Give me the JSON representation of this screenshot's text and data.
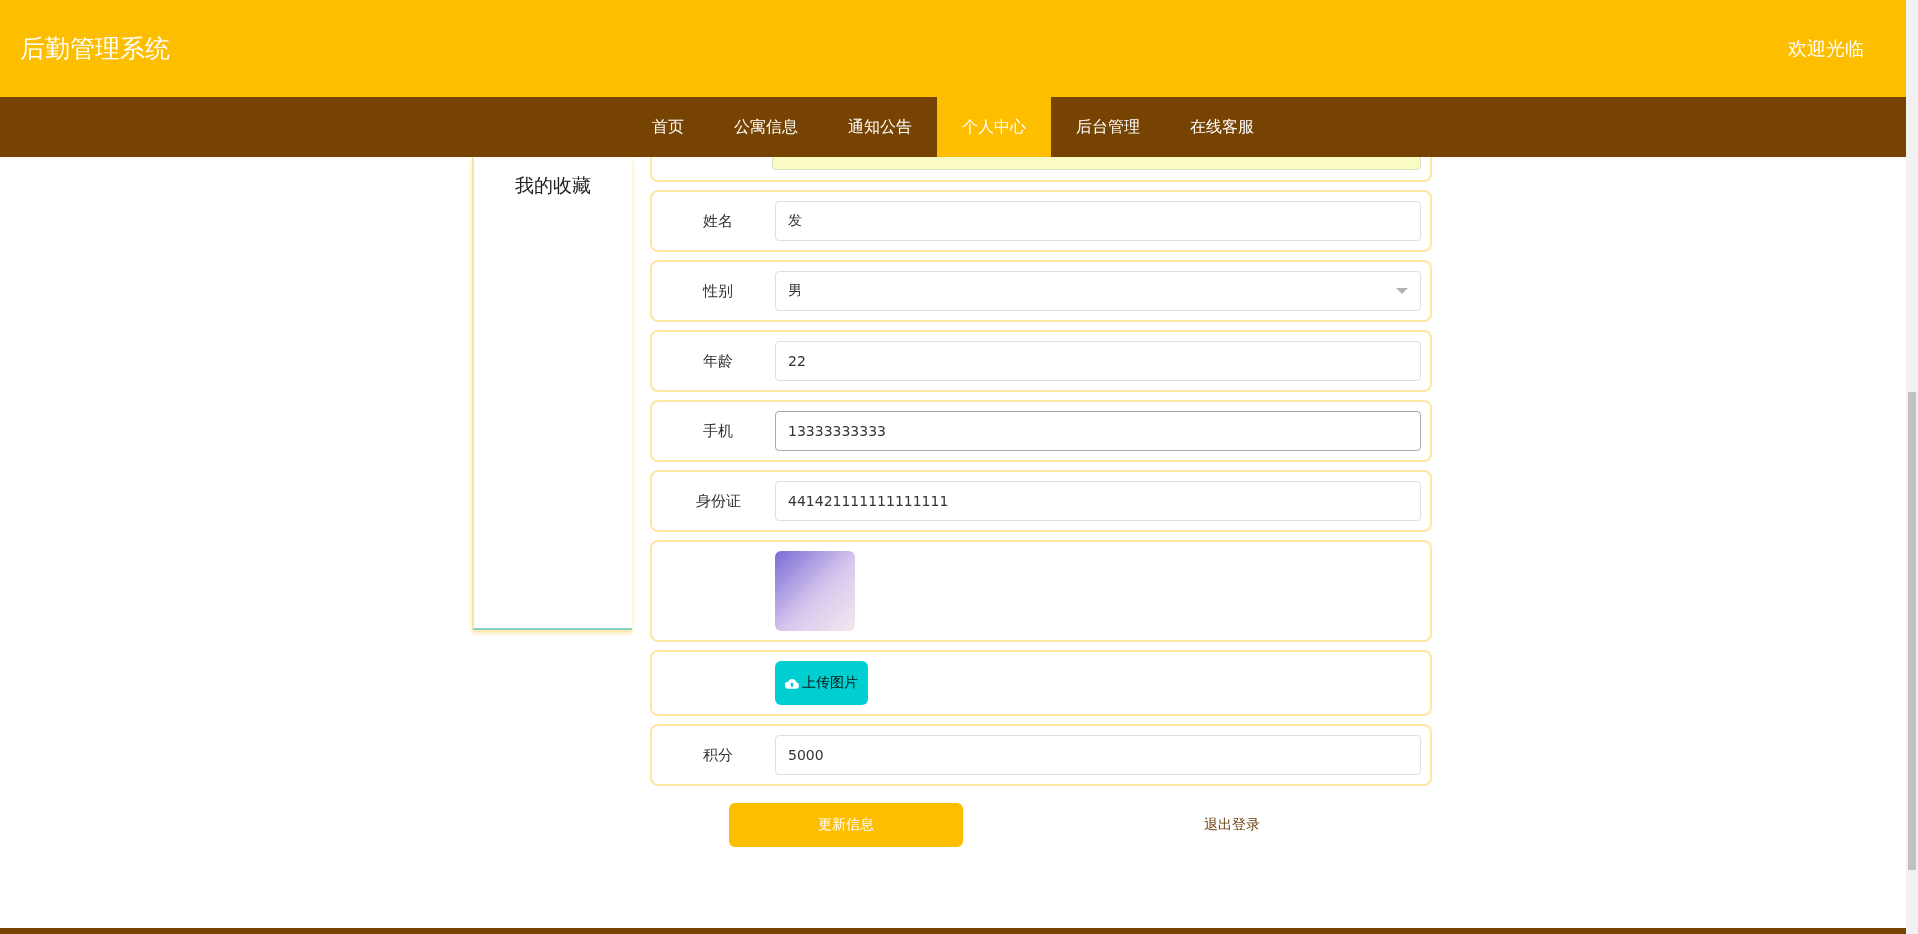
{
  "header": {
    "title": "后勤管理系统",
    "welcome": "欢迎光临"
  },
  "nav": [
    {
      "label": "首页",
      "selected": false
    },
    {
      "label": "公寓信息",
      "selected": false
    },
    {
      "label": "通知公告",
      "selected": false
    },
    {
      "label": "个人中心",
      "selected": true
    },
    {
      "label": "后台管理",
      "selected": false
    },
    {
      "label": "在线客服",
      "selected": false
    }
  ],
  "sidebar": {
    "items": [
      {
        "label": "我的收藏"
      }
    ]
  },
  "form": {
    "rows": [
      {
        "kind": "cut"
      },
      {
        "kind": "input",
        "label": "姓名",
        "value": "发",
        "focused": false
      },
      {
        "kind": "select",
        "label": "性别",
        "value": "男"
      },
      {
        "kind": "input",
        "label": "年龄",
        "value": "22",
        "focused": false
      },
      {
        "kind": "input",
        "label": "手机",
        "value": "13333333333",
        "focused": true
      },
      {
        "kind": "input",
        "label": "身份证",
        "value": "441421111111111111",
        "focused": false
      },
      {
        "kind": "image"
      },
      {
        "kind": "upload",
        "button": "上传图片"
      },
      {
        "kind": "input",
        "label": "积分",
        "value": "5000",
        "focused": false
      }
    ]
  },
  "actions": {
    "update": "更新信息",
    "logout": "退出登录"
  }
}
